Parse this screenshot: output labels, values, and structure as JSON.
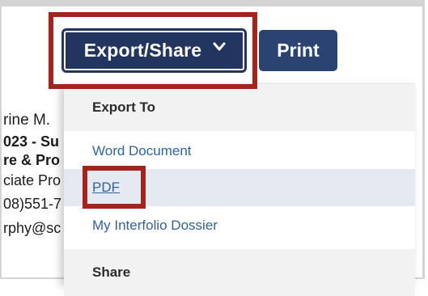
{
  "toolbar": {
    "export_label": "Export/Share",
    "print_label": "Print"
  },
  "background": {
    "lines": [
      "rine M.",
      "023 - Su",
      "re & Pro",
      "ciate Pro",
      "08)551-7",
      "rphy@sc"
    ]
  },
  "dropdown": {
    "export_header": "Export To",
    "items": [
      "Word Document",
      "PDF",
      "My Interfolio Dossier"
    ],
    "share_header": "Share"
  },
  "colors": {
    "primary_button": "#21355e",
    "print_button": "#2a4371",
    "link": "#2e64a3",
    "highlight_box": "#a6231b",
    "selected_row": "#e5e9f1"
  },
  "icons": {
    "export_chevron": "chevron-down-icon"
  }
}
